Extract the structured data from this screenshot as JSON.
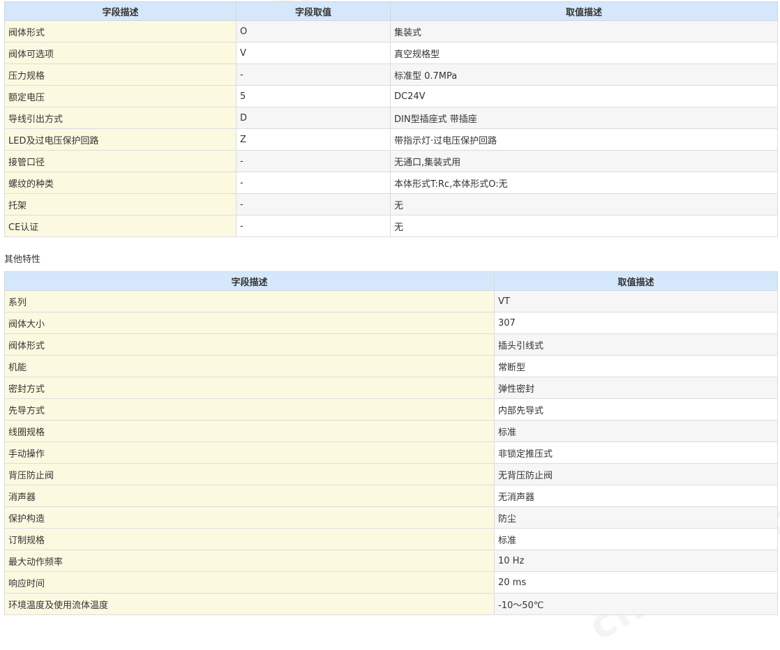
{
  "table1": {
    "headers": [
      "字段描述",
      "字段取值",
      "取值描述"
    ],
    "rows": [
      [
        "阀体形式",
        "O",
        "集装式"
      ],
      [
        "阀体可选项",
        "V",
        "真空规格型"
      ],
      [
        "压力规格",
        "-",
        "标准型 0.7MPa"
      ],
      [
        "额定电压",
        "5",
        "DC24V"
      ],
      [
        "导线引出方式",
        "D",
        "DIN型插座式 带插座"
      ],
      [
        "LED及过电压保护回路",
        "Z",
        "带指示灯·过电压保护回路"
      ],
      [
        "接管口径",
        "-",
        "无通口,集装式用"
      ],
      [
        "螺纹的种类",
        "-",
        "本体形式T:Rc,本体形式O:无"
      ],
      [
        "托架",
        "-",
        "无"
      ],
      [
        "CE认证",
        "-",
        "无"
      ]
    ]
  },
  "section2_title": "其他特性",
  "table2": {
    "headers": [
      "字段描述",
      "取值描述"
    ],
    "rows": [
      [
        "系列",
        "VT"
      ],
      [
        "阀体大小",
        "307"
      ],
      [
        "阀体形式",
        "插头引线式"
      ],
      [
        "机能",
        "常断型"
      ],
      [
        "密封方式",
        "弹性密封"
      ],
      [
        "先导方式",
        "内部先导式"
      ],
      [
        "线圈规格",
        "标准"
      ],
      [
        "手动操作",
        "非锁定推压式"
      ],
      [
        "背压防止阀",
        "无背压防止阀"
      ],
      [
        "消声器",
        "无消声器"
      ],
      [
        "保护构造",
        "防尘"
      ],
      [
        "订制规格",
        "标准"
      ],
      [
        "最大动作频率",
        "10 Hz"
      ],
      [
        "响应时间",
        "20 ms"
      ],
      [
        "环境温度及使用流体温度",
        "-10～50℃"
      ]
    ]
  },
  "watermark_text": "chem17.com",
  "colors": {
    "header_bg": "#d5e8fb",
    "label_bg": "#fcf9e1",
    "alt_row_bg": "#f6f6f6"
  }
}
